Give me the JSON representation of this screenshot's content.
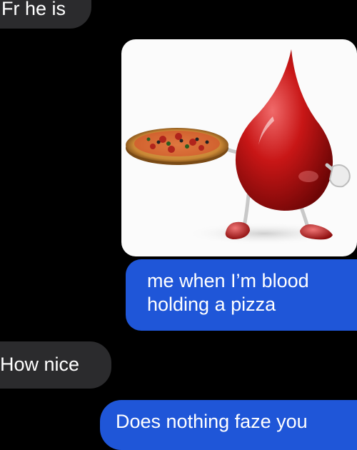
{
  "conversation": {
    "messages": [
      {
        "from": "received",
        "text": "Fr he is"
      },
      {
        "from": "sent",
        "type": "image"
      },
      {
        "from": "sent",
        "text": "me when I’m blood holding a pizza"
      },
      {
        "from": "received",
        "text": "How nice"
      },
      {
        "from": "sent",
        "text": "Does nothing faze you"
      }
    ]
  },
  "colors": {
    "background": "#000000",
    "received_bubble": "#2b2b2d",
    "sent_bubble": "#1f56d8",
    "text": "#ffffff"
  }
}
